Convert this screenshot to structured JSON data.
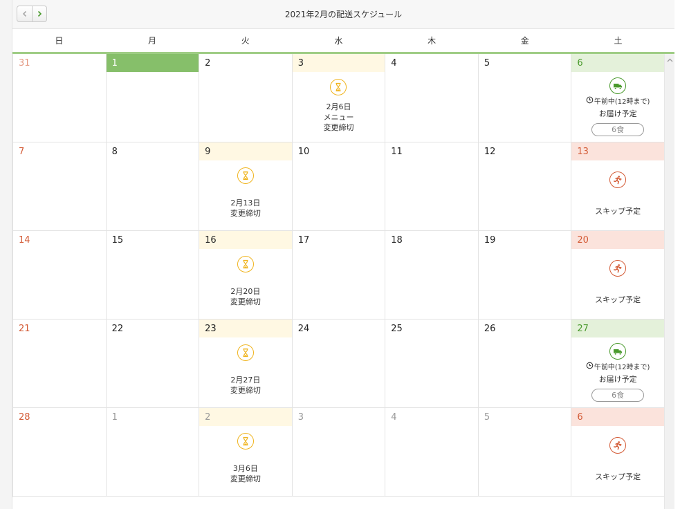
{
  "toolbar": {
    "title": "2021年2月の配送スケジュール",
    "prev_icon": "chevron-left-icon",
    "next_icon": "chevron-right-icon"
  },
  "weekdays": [
    "日",
    "月",
    "火",
    "水",
    "木",
    "金",
    "土"
  ],
  "colors": {
    "accent_green": "#86bf6a",
    "delivery_green": "#4a9a2d",
    "deadline_yellow": "#f0b41e",
    "skip_red": "#d35a35"
  },
  "weeks": [
    [
      {
        "day": "31",
        "other": true
      },
      {
        "day": "1",
        "today": true
      },
      {
        "day": "2"
      },
      {
        "day": "3",
        "type": "deadline",
        "lines": [
          "2月6日",
          "メニュー",
          "変更締切"
        ]
      },
      {
        "day": "4"
      },
      {
        "day": "5"
      },
      {
        "day": "6",
        "type": "delivery",
        "time": "午前中(12時まで)",
        "label": "お届け予定",
        "meals": "6食"
      }
    ],
    [
      {
        "day": "7"
      },
      {
        "day": "8"
      },
      {
        "day": "9",
        "type": "deadline",
        "lines": [
          "2月13日",
          "変更締切"
        ]
      },
      {
        "day": "10"
      },
      {
        "day": "11"
      },
      {
        "day": "12"
      },
      {
        "day": "13",
        "type": "skip",
        "label": "スキップ予定"
      }
    ],
    [
      {
        "day": "14"
      },
      {
        "day": "15"
      },
      {
        "day": "16",
        "type": "deadline",
        "lines": [
          "2月20日",
          "変更締切"
        ]
      },
      {
        "day": "17"
      },
      {
        "day": "18"
      },
      {
        "day": "19"
      },
      {
        "day": "20",
        "type": "skip",
        "label": "スキップ予定"
      }
    ],
    [
      {
        "day": "21"
      },
      {
        "day": "22"
      },
      {
        "day": "23",
        "type": "deadline",
        "lines": [
          "2月27日",
          "変更締切"
        ]
      },
      {
        "day": "24"
      },
      {
        "day": "25"
      },
      {
        "day": "26"
      },
      {
        "day": "27",
        "type": "delivery",
        "time": "午前中(12時まで)",
        "label": "お届け予定",
        "meals": "6食"
      }
    ],
    [
      {
        "day": "28"
      },
      {
        "day": "1",
        "other": true
      },
      {
        "day": "2",
        "other": true,
        "type": "deadline",
        "lines": [
          "3月6日",
          "変更締切"
        ]
      },
      {
        "day": "3",
        "other": true
      },
      {
        "day": "4",
        "other": true
      },
      {
        "day": "5",
        "other": true
      },
      {
        "day": "6",
        "other": true,
        "type": "skip",
        "label": "スキップ予定"
      }
    ]
  ]
}
